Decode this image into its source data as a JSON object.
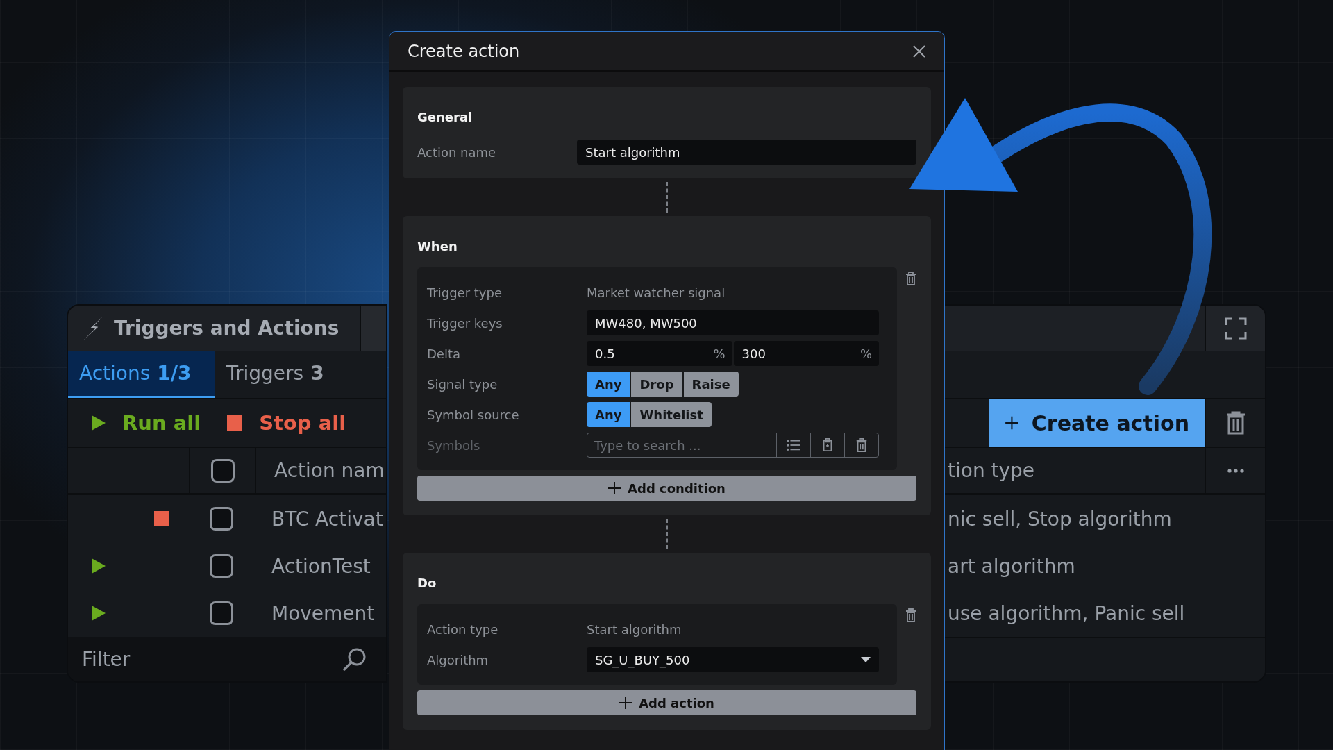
{
  "panel": {
    "title": "Triggers and Actions",
    "tabs": [
      {
        "label": "Actions",
        "count": "1/3",
        "selected": true
      },
      {
        "label": "Triggers",
        "count": "3",
        "selected": false
      }
    ],
    "toolbar": [
      {
        "kind": "run",
        "label": "Run all"
      },
      {
        "kind": "stop",
        "label": "Stop all"
      }
    ],
    "create_button": "Create action",
    "select_all_checked": false,
    "column_left": "Action nam",
    "column_right": "tion type",
    "rows": [
      {
        "running": true,
        "checked": false,
        "name": "BTC Activat",
        "action_types": "nic sell, Stop algorithm"
      },
      {
        "running": false,
        "checked": false,
        "name": "ActionTest",
        "action_types": "art algorithm"
      },
      {
        "running": false,
        "checked": false,
        "name": "Movement",
        "action_types": "use algorithm, Panic sell"
      }
    ],
    "filter": {
      "placeholder": "Filter"
    }
  },
  "dialog": {
    "title": "Create action",
    "general": {
      "heading": "General",
      "fields": [
        {
          "kind": "input",
          "label": "Action name",
          "value": "Start algorithm"
        }
      ]
    },
    "when": {
      "heading": "When",
      "condition": {
        "fields": [
          {
            "kind": "text",
            "label": "Trigger type",
            "value": "Market watcher signal"
          },
          {
            "kind": "input",
            "label": "Trigger keys",
            "value": "MW480, MW500"
          },
          {
            "kind": "pair",
            "label": "Delta",
            "values": [
              {
                "value": "0.5",
                "unit": "%"
              },
              {
                "value": "300",
                "unit": "%"
              }
            ]
          },
          {
            "kind": "segmented",
            "label": "Signal type",
            "options": [
              {
                "label": "Any",
                "selected": true
              },
              {
                "label": "Drop",
                "selected": false
              },
              {
                "label": "Raise",
                "selected": false
              }
            ]
          },
          {
            "kind": "segmented",
            "label": "Symbol source",
            "options": [
              {
                "label": "Any",
                "selected": true
              },
              {
                "label": "Whitelist",
                "selected": false
              }
            ]
          },
          {
            "kind": "search",
            "label": "Symbols",
            "placeholder": "Type to search ...",
            "disabled": true
          }
        ]
      },
      "add_button": "Add condition"
    },
    "do": {
      "heading": "Do",
      "action": {
        "fields": [
          {
            "kind": "text",
            "label": "Action type",
            "value": "Start algorithm"
          },
          {
            "kind": "select",
            "label": "Algorithm",
            "value": "SG_U_BUY_500"
          }
        ]
      },
      "add_button": "Add action"
    }
  }
}
